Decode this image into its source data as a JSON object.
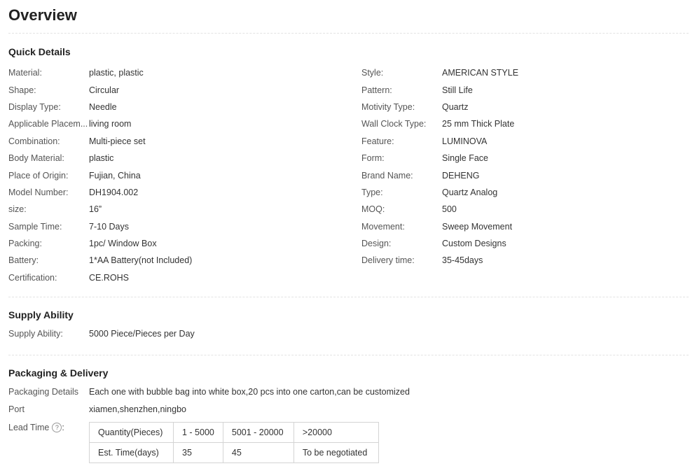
{
  "page_title": "Overview",
  "quick_details": {
    "title": "Quick Details",
    "left": [
      {
        "k": "Material:",
        "v": "plastic, plastic"
      },
      {
        "k": "Shape:",
        "v": "Circular"
      },
      {
        "k": "Display Type:",
        "v": "Needle"
      },
      {
        "k": "Applicable Placem...",
        "v": "living room"
      },
      {
        "k": "Combination:",
        "v": "Multi-piece set"
      },
      {
        "k": "Body Material:",
        "v": "plastic"
      },
      {
        "k": "Place of Origin:",
        "v": "Fujian, China"
      },
      {
        "k": "Model Number:",
        "v": "DH1904.002"
      },
      {
        "k": "size:",
        "v": "16”"
      },
      {
        "k": "Sample Time:",
        "v": "7-10 Days"
      },
      {
        "k": "Packing:",
        "v": "1pc/ Window Box"
      },
      {
        "k": "Battery:",
        "v": "1*AA Battery(not Included)"
      },
      {
        "k": "Certification:",
        "v": "CE.ROHS"
      }
    ],
    "right": [
      {
        "k": "Style:",
        "v": "AMERICAN STYLE"
      },
      {
        "k": "Pattern:",
        "v": "Still Life"
      },
      {
        "k": "Motivity Type:",
        "v": "Quartz"
      },
      {
        "k": "Wall Clock Type:",
        "v": "25 mm Thick Plate"
      },
      {
        "k": "Feature:",
        "v": "LUMINOVA"
      },
      {
        "k": "Form:",
        "v": "Single Face"
      },
      {
        "k": "Brand Name:",
        "v": "DEHENG"
      },
      {
        "k": "Type:",
        "v": "Quartz Analog"
      },
      {
        "k": "MOQ:",
        "v": "500"
      },
      {
        "k": "Movement:",
        "v": "Sweep Movement"
      },
      {
        "k": "Design:",
        "v": "Custom Designs"
      },
      {
        "k": "Delivery time:",
        "v": "35-45days"
      }
    ]
  },
  "supply_ability": {
    "title": "Supply Ability",
    "row": {
      "k": "Supply Ability:",
      "v": "5000 Piece/Pieces per Day"
    }
  },
  "packaging": {
    "title": "Packaging & Delivery",
    "details": {
      "k": "Packaging Details",
      "v": "Each one with bubble bag into white box,20 pcs into one carton,can be customized"
    },
    "port": {
      "k": "Port",
      "v": "xiamen,shenzhen,ningbo"
    },
    "lead_time_label": "Lead Time",
    "help_icon": "question-circle-icon",
    "lead_table": [
      [
        "Quantity(Pieces)",
        "1 - 5000",
        "5001 - 20000",
        ">20000"
      ],
      [
        "Est. Time(days)",
        "35",
        "45",
        "To be negotiated"
      ]
    ]
  }
}
